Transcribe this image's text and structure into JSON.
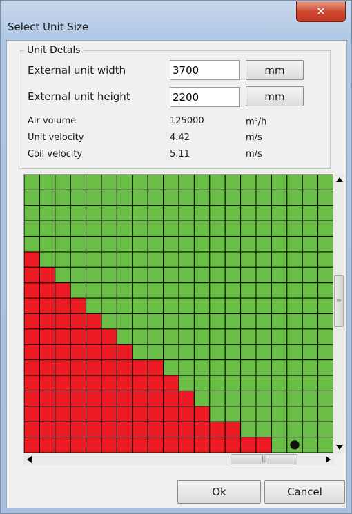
{
  "window": {
    "title": "Select Unit Size",
    "close_glyph": "✕"
  },
  "details": {
    "legend": "Unit Detals",
    "width_label": "External unit width",
    "width_value": "3700",
    "width_unit": "mm",
    "height_label": "External unit height",
    "height_value": "2200",
    "height_unit": "mm",
    "air_volume_label": "Air volume",
    "air_volume_value": "125000",
    "air_volume_unit_base": "m",
    "air_volume_unit_sup": "3",
    "air_volume_unit_tail": "/h",
    "unit_velocity_label": "Unit velocity",
    "unit_velocity_value": "4.42",
    "unit_velocity_unit": "m/s",
    "coil_velocity_label": "Coil velocity",
    "coil_velocity_value": "5.11",
    "coil_velocity_unit": "m/s"
  },
  "grid": {
    "columns": 20,
    "rows": 18,
    "red_cells_per_row": [
      0,
      0,
      0,
      0,
      0,
      1,
      2,
      3,
      4,
      5,
      6,
      7,
      9,
      10,
      11,
      12,
      14,
      16
    ],
    "selected_cell": {
      "row": 17,
      "column": 17
    },
    "colors": {
      "ok": "#6abd45",
      "bad": "#ed1c24",
      "line": "#000000",
      "marker": "#111111"
    }
  },
  "scrollbars": {
    "vertical_thumb_fraction": 0.45,
    "horizontal_thumb_fraction": 0.88
  },
  "footer": {
    "ok_label": "Ok",
    "cancel_label": "Cancel"
  }
}
